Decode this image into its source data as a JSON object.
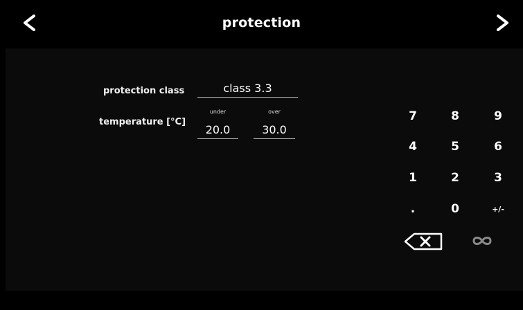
{
  "header": {
    "title": "protection",
    "prev_icon": "chevron-left-icon",
    "next_icon": "chevron-right-icon"
  },
  "form": {
    "protection_class": {
      "label": "protection class",
      "value": "class 3.3"
    },
    "temperature": {
      "label": "temperature [°C]",
      "under": {
        "sublabel": "under",
        "value": "20.0"
      },
      "over": {
        "sublabel": "over",
        "value": "30.0"
      }
    }
  },
  "keypad": {
    "keys": [
      "7",
      "8",
      "9",
      "4",
      "5",
      "6",
      "1",
      "2",
      "3",
      ".",
      "0",
      "+/-"
    ],
    "backspace_icon": "backspace-icon",
    "infinity_icon": "infinity-icon"
  },
  "colors": {
    "background": "#000000",
    "panel": "#0b0b0b",
    "text": "#ffffff",
    "underline": "#bdbdbd",
    "disabled": "#8a8a8a"
  }
}
